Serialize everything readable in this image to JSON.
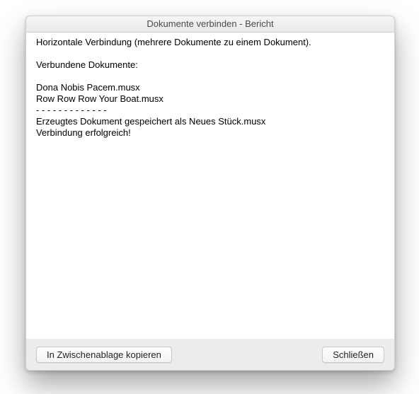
{
  "window": {
    "title": "Dokumente verbinden - Bericht"
  },
  "report": {
    "text": "Horizontale Verbindung (mehrere Dokumente zu einem Dokument).\n\nVerbundene Dokumente:\n\nDona Nobis Pacem.musx\nRow Row Row Your Boat.musx\n- - - - - - - - - - - - -\nErzeugtes Dokument gespeichert als Neues Stück.musx\nVerbindung erfolgreich!"
  },
  "buttons": {
    "copy": "In Zwischenablage kopieren",
    "close": "Schließen"
  }
}
